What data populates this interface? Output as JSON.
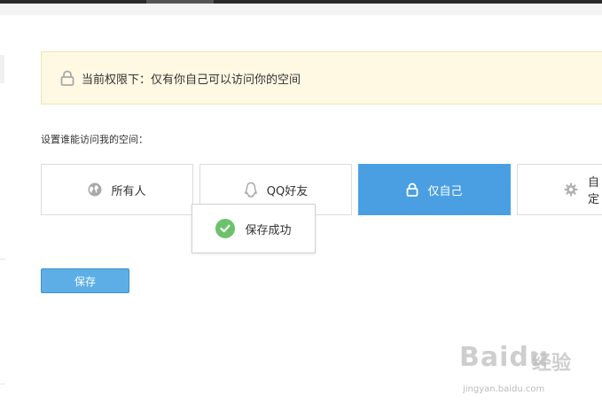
{
  "notice": {
    "text": "当前权限下：仅有你自己可以访问你的空间"
  },
  "section_label": "设置谁能访问我的空间：",
  "options": [
    {
      "label": "所有人",
      "icon": "globe-icon",
      "selected": false
    },
    {
      "label": "QQ好友",
      "icon": "qq-penguin-icon",
      "selected": false
    },
    {
      "label": "仅自己",
      "icon": "lock-icon",
      "selected": true
    },
    {
      "label": "自定",
      "icon": "gear-icon",
      "selected": false
    }
  ],
  "toast": {
    "text": "保存成功",
    "icon": "check-circle-icon"
  },
  "save_button": {
    "label": "保存"
  },
  "watermark": {
    "brand": "Baidu",
    "brand_cn": "经验",
    "url": "jingyan.baidu.com"
  },
  "colors": {
    "selected_blue": "#4a9fe3",
    "notice_bg": "#fff8e3",
    "success_green": "#6bc26b",
    "save_button_blue": "#5daee6"
  }
}
